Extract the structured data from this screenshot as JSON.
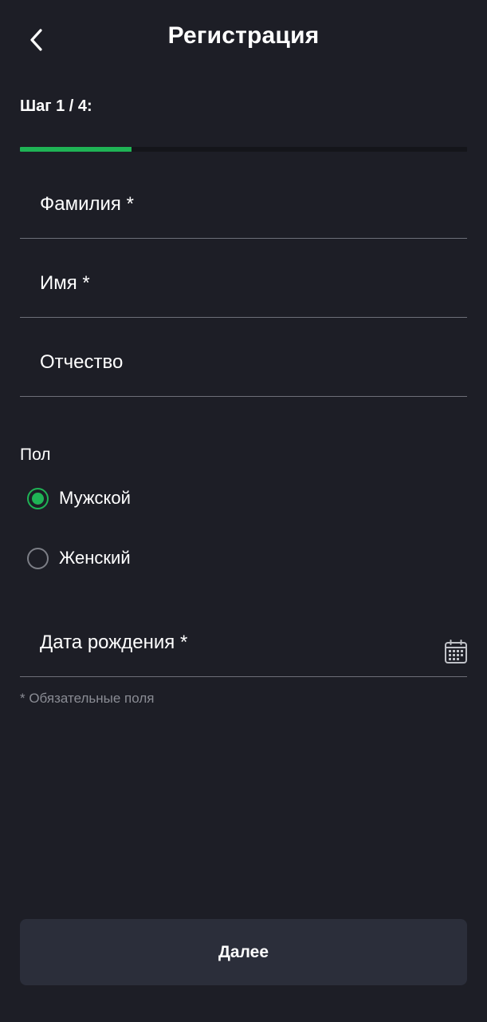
{
  "header": {
    "title": "Регистрация",
    "back_icon": "chevron-left-icon"
  },
  "step": {
    "label": "Шаг 1 / 4:",
    "current": 1,
    "total": 4,
    "progress_fraction": 0.25
  },
  "fields": {
    "last_name": {
      "label": "Фамилия *",
      "value": ""
    },
    "first_name": {
      "label": "Имя *",
      "value": ""
    },
    "patronymic": {
      "label": "Отчество",
      "value": ""
    },
    "birth_date": {
      "label": "Дата рождения *",
      "value": "",
      "icon": "calendar-icon"
    }
  },
  "gender": {
    "label": "Пол",
    "options": [
      {
        "label": "Мужской",
        "checked": true
      },
      {
        "label": "Женский",
        "checked": false
      }
    ]
  },
  "hint": "* Обязательные поля",
  "actions": {
    "next_label": "Далее"
  },
  "colors": {
    "background": "#1d1e26",
    "accent": "#1fb355",
    "divider": "#6d6f78",
    "button_bg": "#2b2e3a",
    "hint_text": "#8a8c94"
  }
}
